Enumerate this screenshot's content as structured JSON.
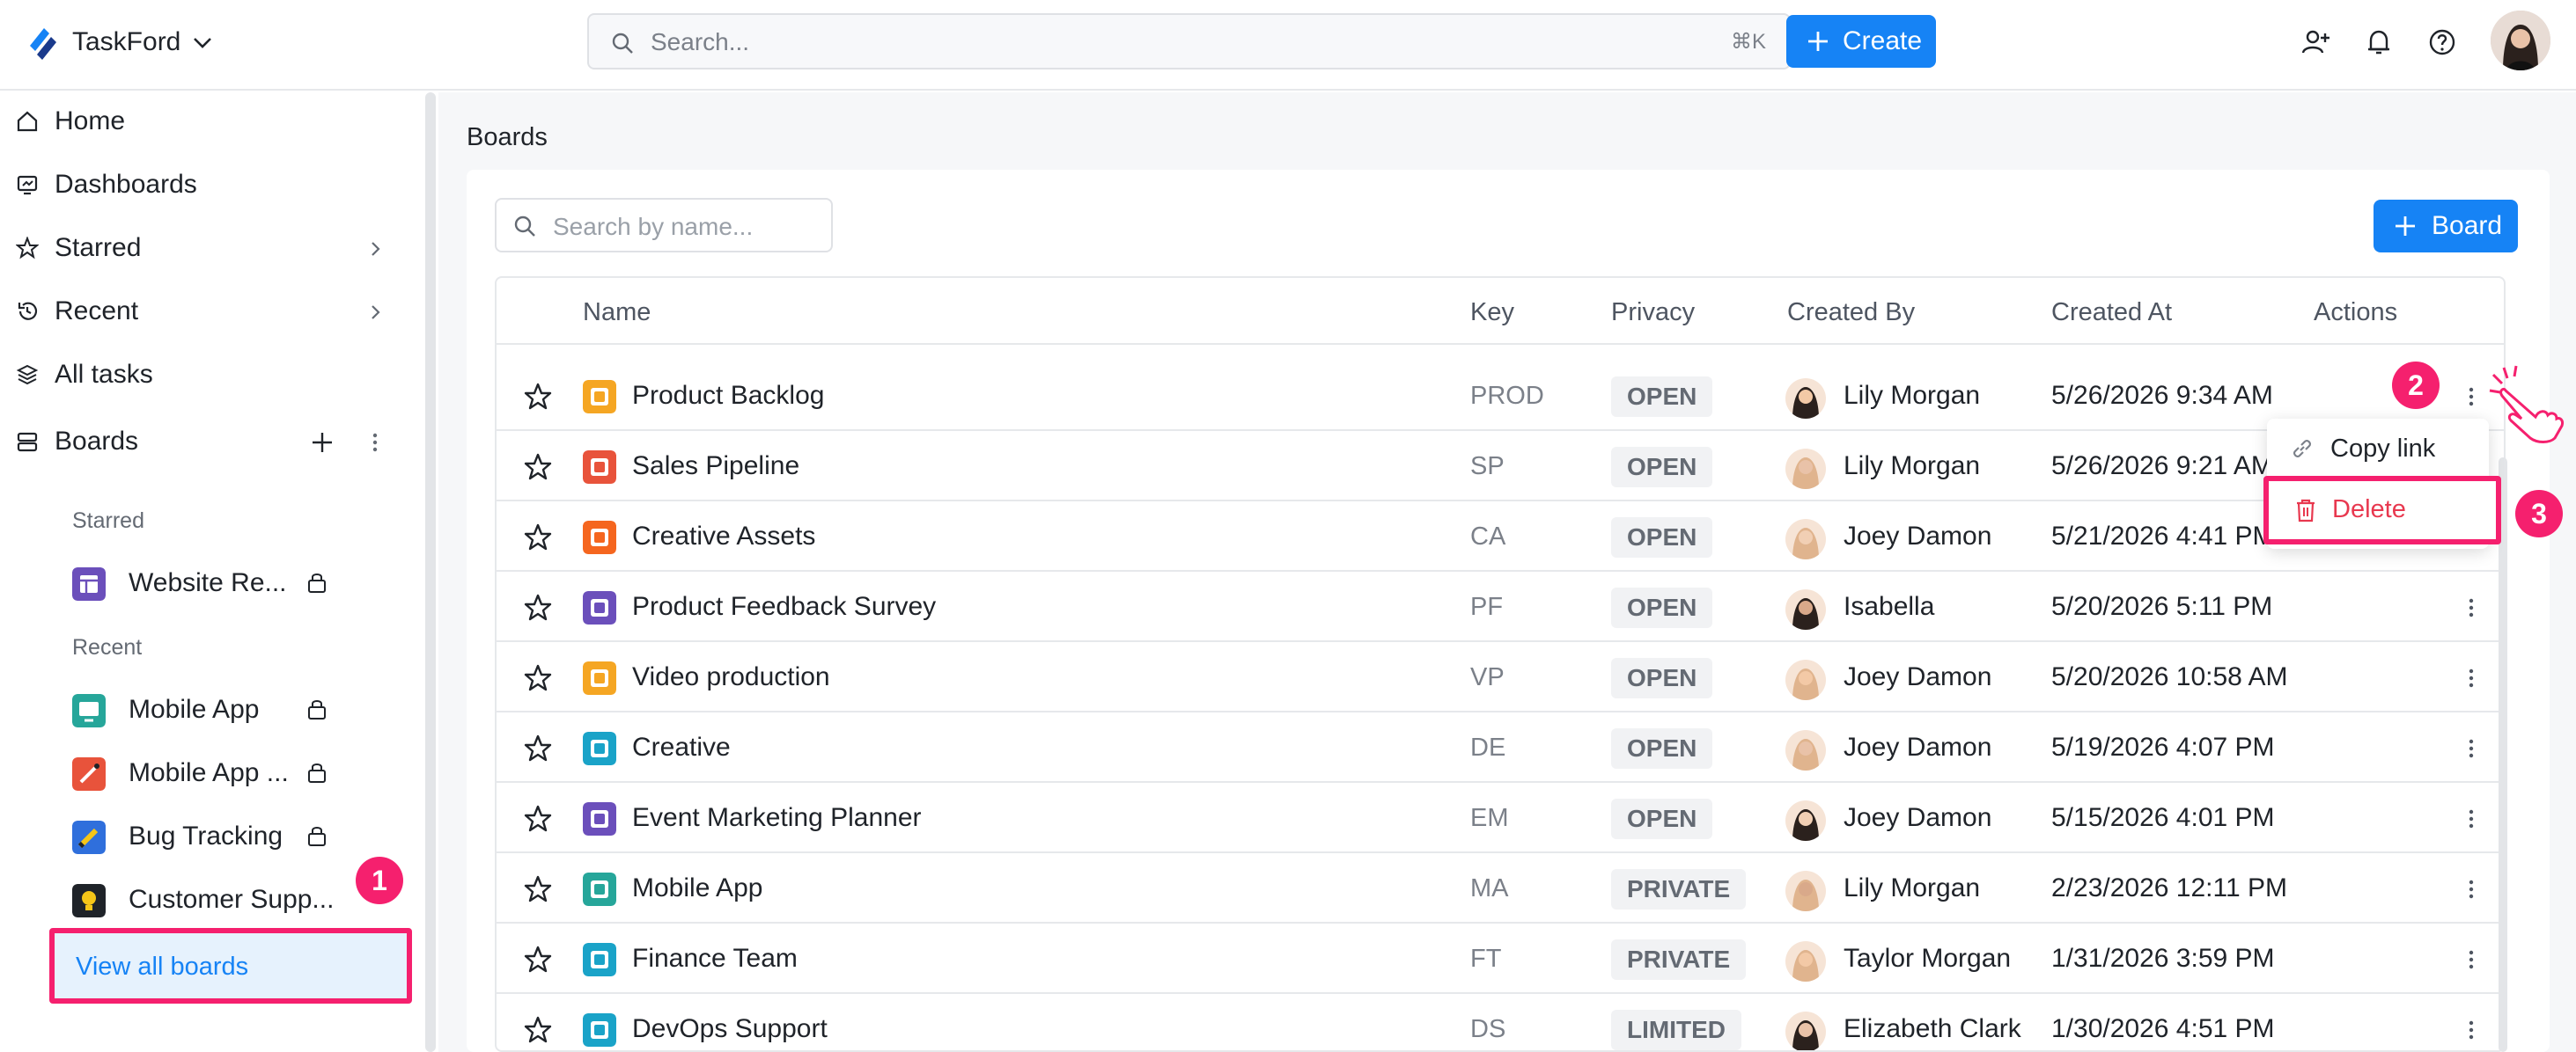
{
  "app": {
    "name": "TaskFord"
  },
  "header": {
    "search_placeholder": "Search...",
    "search_shortcut": "⌘K",
    "create_label": "Create"
  },
  "sidebar": {
    "nav": [
      {
        "label": "Home",
        "icon": "home-icon"
      },
      {
        "label": "Dashboards",
        "icon": "dashboard-icon"
      },
      {
        "label": "Starred",
        "icon": "star-icon"
      },
      {
        "label": "Recent",
        "icon": "history-icon"
      },
      {
        "label": "All tasks",
        "icon": "layers-icon"
      },
      {
        "label": "Boards",
        "icon": "boards-icon"
      }
    ],
    "starred_label": "Starred",
    "recent_label": "Recent",
    "starred_boards": [
      {
        "label": "Website Re...",
        "color": "#6b4fbb"
      }
    ],
    "recent_boards": [
      {
        "label": "Mobile App",
        "color": "#26a69a"
      },
      {
        "label": "Mobile App ...",
        "color": "#e8533b"
      },
      {
        "label": "Bug Tracking",
        "color": "#2f6fdc"
      },
      {
        "label": "Customer Supp...",
        "color": "#1f2329"
      }
    ],
    "view_all_label": "View all boards"
  },
  "main": {
    "title": "Boards",
    "search_placeholder": "Search by name...",
    "board_button_label": "Board",
    "columns": [
      "Name",
      "Key",
      "Privacy",
      "Created By",
      "Created At",
      "Actions"
    ],
    "rows": [
      {
        "name": "Product Backlog",
        "key": "PROD",
        "privacy": "OPEN",
        "creator": "Lily Morgan",
        "created": "5/26/2026 9:34 AM",
        "color": "#f5a623"
      },
      {
        "name": "Sales Pipeline",
        "key": "SP",
        "privacy": "OPEN",
        "creator": "Lily Morgan",
        "created": "5/26/2026 9:21 AM",
        "color": "#e8533b"
      },
      {
        "name": "Creative Assets",
        "key": "CA",
        "privacy": "OPEN",
        "creator": "Joey Damon",
        "created": "5/21/2026 4:41 PM",
        "color": "#f5661f"
      },
      {
        "name": "Product Feedback Survey",
        "key": "PF",
        "privacy": "OPEN",
        "creator": "Isabella",
        "created": "5/20/2026 5:11 PM",
        "color": "#6b4fbb"
      },
      {
        "name": "Video production",
        "key": "VP",
        "privacy": "OPEN",
        "creator": "Joey Damon",
        "created": "5/20/2026 10:58 AM",
        "color": "#f5a623"
      },
      {
        "name": "Creative",
        "key": "DE",
        "privacy": "OPEN",
        "creator": "Joey Damon",
        "created": "5/19/2026 4:07 PM",
        "color": "#1aa3c8"
      },
      {
        "name": "Event Marketing Planner",
        "key": "EM",
        "privacy": "OPEN",
        "creator": "Joey Damon",
        "created": "5/15/2026 4:01 PM",
        "color": "#6b4fbb"
      },
      {
        "name": "Mobile App",
        "key": "MA",
        "privacy": "PRIVATE",
        "creator": "Lily Morgan",
        "created": "2/23/2026 12:11 PM",
        "color": "#26a69a"
      },
      {
        "name": "Finance Team",
        "key": "FT",
        "privacy": "PRIVATE",
        "creator": "Taylor Morgan",
        "created": "1/31/2026 3:59 PM",
        "color": "#1aa3c8"
      },
      {
        "name": "DevOps Support",
        "key": "DS",
        "privacy": "LIMITED",
        "creator": "Elizabeth Clark",
        "created": "1/30/2026 4:51 PM",
        "color": "#1aa3c8"
      }
    ],
    "menu": {
      "copy_link": "Copy link",
      "delete": "Delete"
    }
  },
  "annotations": [
    "1",
    "2",
    "3"
  ],
  "colors": {
    "accent": "#1683f5",
    "highlight": "#f5206e",
    "danger": "#e8384f"
  }
}
